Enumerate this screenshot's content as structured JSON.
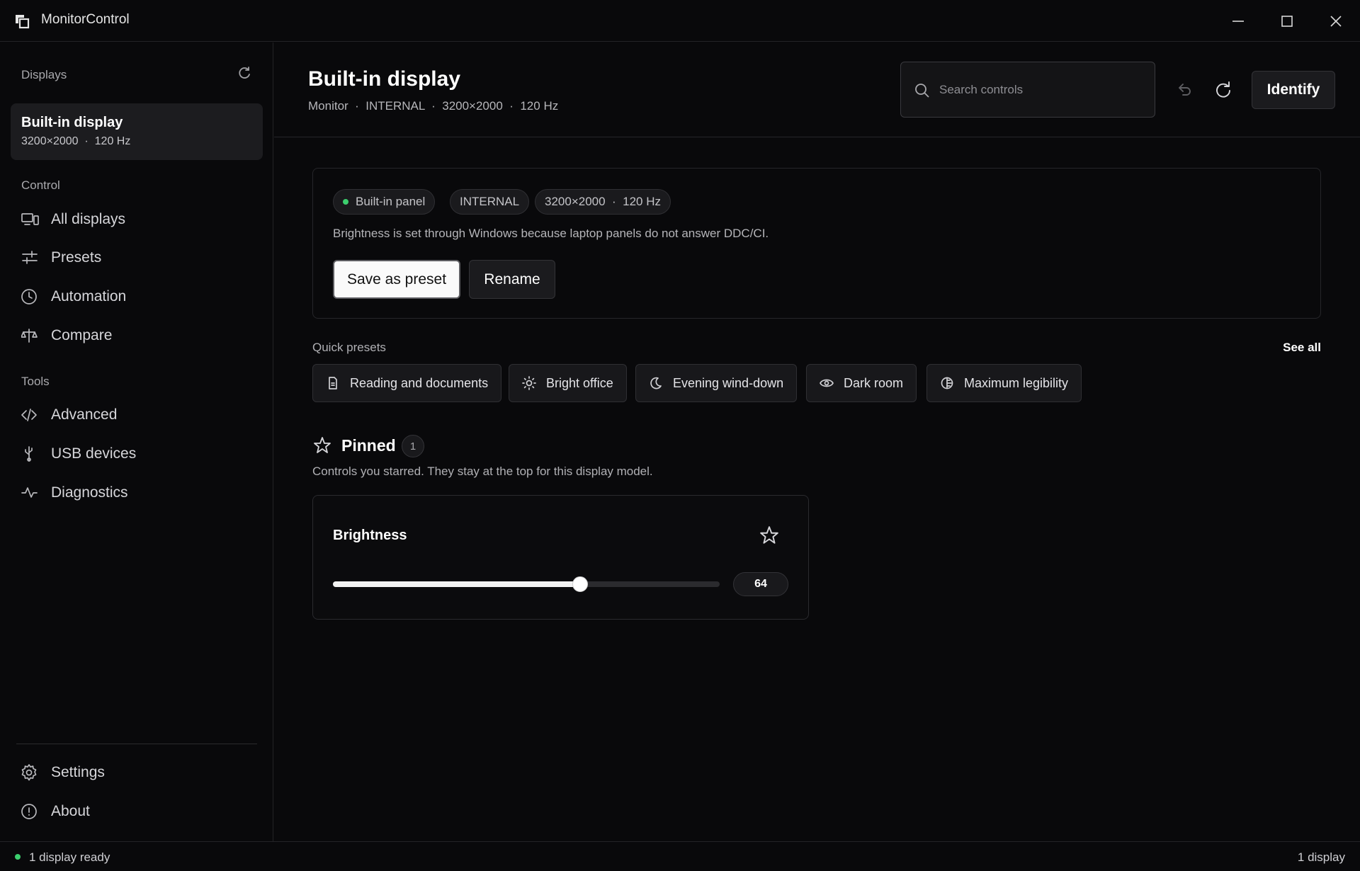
{
  "app": {
    "title": "MonitorControl",
    "window_controls": [
      "minimize-icon",
      "maximize-icon",
      "close-icon"
    ]
  },
  "sidebar": {
    "displays_heading": "Displays",
    "refresh_icon": "refresh-icon",
    "display_card": {
      "title": "Built-in display",
      "subtitle": "3200×2000  ·  120 Hz"
    },
    "control_heading": "Control",
    "control_items": [
      {
        "label": "All displays",
        "icon": "monitors-icon"
      },
      {
        "label": "Presets",
        "icon": "sliders-icon"
      },
      {
        "label": "Automation",
        "icon": "clock-icon"
      },
      {
        "label": "Compare",
        "icon": "scale-icon"
      }
    ],
    "tools_heading": "Tools",
    "tools_items": [
      {
        "label": "Advanced",
        "icon": "code-icon"
      },
      {
        "label": "USB devices",
        "icon": "usb-icon"
      },
      {
        "label": "Diagnostics",
        "icon": "pulse-icon"
      }
    ],
    "footer_items": [
      {
        "label": "Settings",
        "icon": "gear-icon"
      },
      {
        "label": "About",
        "icon": "info-icon"
      }
    ]
  },
  "header": {
    "title": "Built-in display",
    "meta": "Monitor  ·  INTERNAL  ·  3200×2000  ·  120 Hz",
    "search_placeholder": "Search controls",
    "identify_label": "Identify"
  },
  "info_card": {
    "pills": [
      "Built-in panel",
      "INTERNAL",
      "3200×2000  ·  120 Hz"
    ],
    "status_color": "#3ccf6e",
    "description": "Brightness is set through Windows because laptop panels do not answer DDC/CI.",
    "save_preset_label": "Save as preset",
    "rename_label": "Rename"
  },
  "quick_presets": {
    "title": "Quick presets",
    "see_all_label": "See all",
    "items": [
      {
        "label": "Reading and documents",
        "icon": "document-icon"
      },
      {
        "label": "Bright office",
        "icon": "sun-icon"
      },
      {
        "label": "Evening wind-down",
        "icon": "moon-icon"
      },
      {
        "label": "Dark room",
        "icon": "eye-icon"
      },
      {
        "label": "Maximum legibility",
        "icon": "contrast-icon"
      }
    ]
  },
  "pinned": {
    "title": "Pinned",
    "count": "1",
    "description": "Controls you starred. They stay at the top for this display model.",
    "controls": [
      {
        "label": "Brightness",
        "value": "64",
        "level": 64,
        "max": 100
      }
    ]
  },
  "status_bar": {
    "left": "1 display ready",
    "right": "1 display",
    "ready_color": "#3ccf6e"
  }
}
